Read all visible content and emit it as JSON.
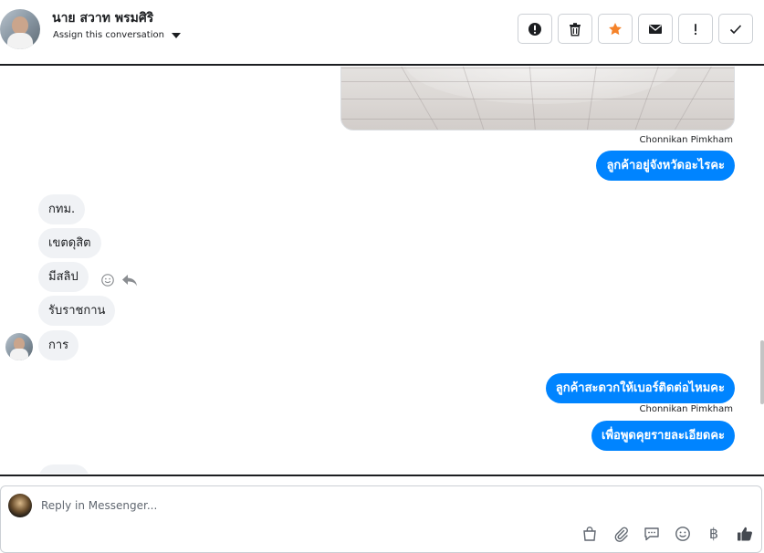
{
  "header": {
    "contact_name": "นาย สวาท พรมศิริ",
    "assign_label": "Assign this conversation",
    "actions": [
      {
        "icon": "alert-circle-icon",
        "label": "Mark as spam"
      },
      {
        "icon": "trash-icon",
        "label": "Delete"
      },
      {
        "icon": "star-icon",
        "label": "Star",
        "color": "#f5832a"
      },
      {
        "icon": "envelope-icon",
        "label": "Mark as unread"
      },
      {
        "icon": "exclamation-icon",
        "label": "Follow up"
      },
      {
        "icon": "check-icon",
        "label": "Mark as done"
      }
    ]
  },
  "thread": {
    "messages": [
      {
        "direction": "out",
        "sender": "Chonnikan Pimkham",
        "text": "ลูกค้าอยู่จังหวัดอะไรคะ"
      },
      {
        "direction": "in",
        "text": "กทม."
      },
      {
        "direction": "in",
        "text": "เขตดุสิต"
      },
      {
        "direction": "in",
        "text": "มีสลิป"
      },
      {
        "direction": "in",
        "text": "รับราชกาน"
      },
      {
        "direction": "in",
        "text": "การ"
      },
      {
        "direction": "out",
        "text": "ลูกค้าสะดวกให้เบอร์ติดต่อไหมคะ"
      },
      {
        "direction": "out",
        "sender": "Chonnikan Pimkham",
        "text": "เพื่อพูดคุยรายละเอียดคะ"
      }
    ],
    "accent_color": "#0084ff"
  },
  "composer": {
    "placeholder": "Reply in Messenger...",
    "tools": [
      "shopping-bag-icon",
      "paperclip-icon",
      "saved-reply-icon",
      "emoji-icon",
      "baht-icon",
      "thumbs-up-icon"
    ],
    "baht_symbol": "฿"
  }
}
